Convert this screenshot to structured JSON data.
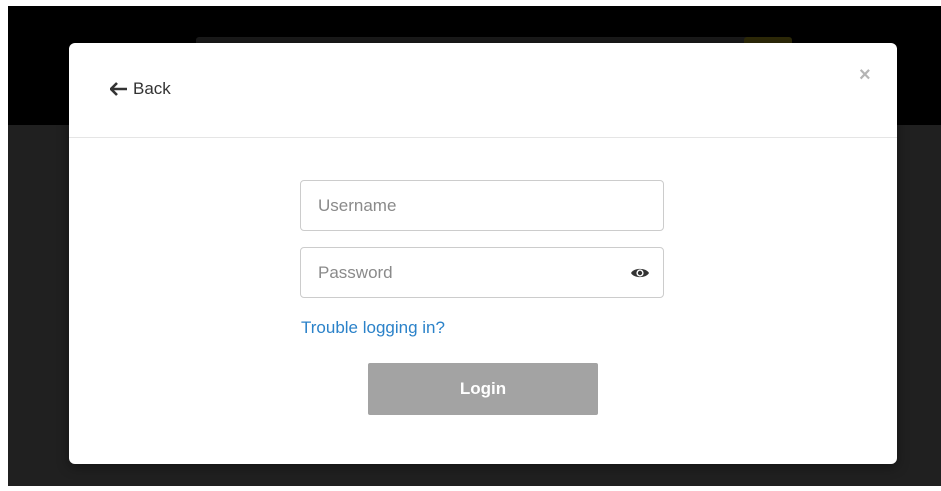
{
  "header": {
    "back_label": "Back",
    "close_label": "×"
  },
  "form": {
    "username": {
      "placeholder": "Username",
      "value": ""
    },
    "password": {
      "placeholder": "Password",
      "value": ""
    },
    "trouble_link": "Trouble logging in?",
    "login_label": "Login"
  },
  "icons": {
    "back": "arrow-left-icon",
    "reveal_password": "eye-icon",
    "close": "close-icon"
  },
  "colors": {
    "link": "#2b82c9",
    "login_button": "#a3a3a3",
    "backdrop": "#202020"
  }
}
